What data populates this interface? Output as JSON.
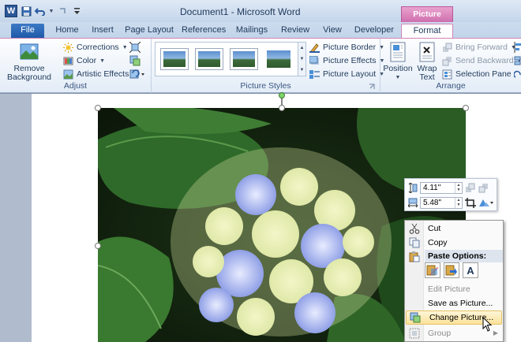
{
  "window": {
    "title": "Document1 - Microsoft Word",
    "contextual_tab_header": "Picture Tools"
  },
  "tabs": {
    "file": "File",
    "home": "Home",
    "insert": "Insert",
    "page_layout": "Page Layout",
    "references": "References",
    "mailings": "Mailings",
    "review": "Review",
    "view": "View",
    "developer": "Developer",
    "format": "Format"
  },
  "ribbon": {
    "adjust": {
      "label": "Adjust",
      "remove_background": "Remove Background",
      "corrections": "Corrections",
      "color": "Color",
      "artistic_effects": "Artistic Effects"
    },
    "picture_styles": {
      "label": "Picture Styles",
      "picture_border": "Picture Border",
      "picture_effects": "Picture Effects",
      "picture_layout": "Picture Layout"
    },
    "arrange": {
      "label": "Arrange",
      "position": "Position",
      "wrap_text": "Wrap Text",
      "bring_forward": "Bring Forward",
      "send_backward": "Send Backward",
      "selection_pane": "Selection Pane"
    }
  },
  "mini_toolbar": {
    "height": "4.11\"",
    "width": "5.48\""
  },
  "context_menu": {
    "cut": "Cut",
    "copy": "Copy",
    "paste_options": "Paste Options:",
    "edit_picture": "Edit Picture",
    "save_as_picture": "Save as Picture...",
    "change_picture": "Change Picture...",
    "group": "Group"
  },
  "colors": {
    "accent_context": "#cf6fae",
    "file_tab": "#2b64b3",
    "ribbon_bg": "#e3ecf7"
  }
}
